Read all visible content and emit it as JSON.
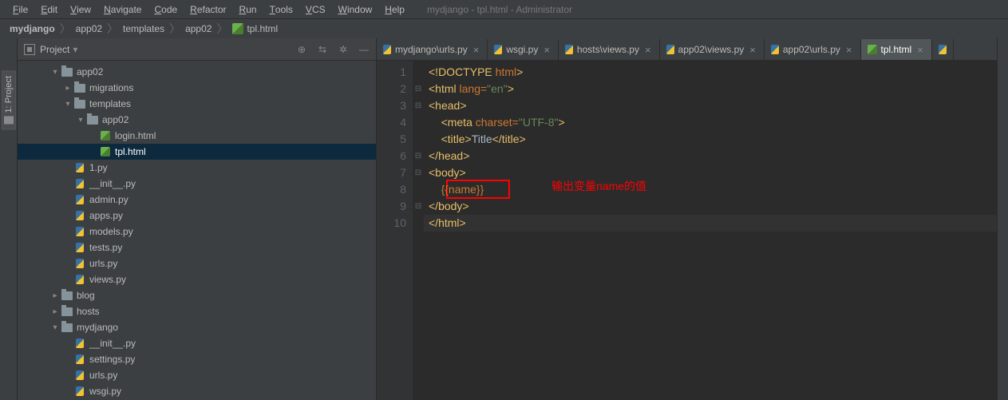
{
  "menu": {
    "items": [
      "File",
      "Edit",
      "View",
      "Navigate",
      "Code",
      "Refactor",
      "Run",
      "Tools",
      "VCS",
      "Window",
      "Help"
    ]
  },
  "title": "mydjango - tpl.html - Administrator",
  "breadcrumb": [
    "mydjango",
    "app02",
    "templates",
    "app02",
    "tpl.html"
  ],
  "sidebar_tab": "1: Project",
  "project_header": {
    "label": "Project"
  },
  "tree": [
    {
      "d": 2,
      "a": "v",
      "t": "folder",
      "n": "app02"
    },
    {
      "d": 3,
      "a": ">",
      "t": "folder",
      "n": "migrations"
    },
    {
      "d": 3,
      "a": "v",
      "t": "folder",
      "n": "templates"
    },
    {
      "d": 4,
      "a": "v",
      "t": "folder",
      "n": "app02"
    },
    {
      "d": 5,
      "a": "",
      "t": "html",
      "n": "login.html"
    },
    {
      "d": 5,
      "a": "",
      "t": "html",
      "n": "tpl.html",
      "sel": true
    },
    {
      "d": 3,
      "a": "",
      "t": "py",
      "n": "1.py"
    },
    {
      "d": 3,
      "a": "",
      "t": "py",
      "n": "__init__.py"
    },
    {
      "d": 3,
      "a": "",
      "t": "py",
      "n": "admin.py"
    },
    {
      "d": 3,
      "a": "",
      "t": "py",
      "n": "apps.py"
    },
    {
      "d": 3,
      "a": "",
      "t": "py",
      "n": "models.py"
    },
    {
      "d": 3,
      "a": "",
      "t": "py",
      "n": "tests.py"
    },
    {
      "d": 3,
      "a": "",
      "t": "py",
      "n": "urls.py"
    },
    {
      "d": 3,
      "a": "",
      "t": "py",
      "n": "views.py"
    },
    {
      "d": 2,
      "a": ">",
      "t": "folder",
      "n": "blog"
    },
    {
      "d": 2,
      "a": ">",
      "t": "folder",
      "n": "hosts"
    },
    {
      "d": 2,
      "a": "v",
      "t": "folder",
      "n": "mydjango"
    },
    {
      "d": 3,
      "a": "",
      "t": "py",
      "n": "__init__.py"
    },
    {
      "d": 3,
      "a": "",
      "t": "py",
      "n": "settings.py"
    },
    {
      "d": 3,
      "a": "",
      "t": "py",
      "n": "urls.py"
    },
    {
      "d": 3,
      "a": "",
      "t": "py",
      "n": "wsgi.py"
    }
  ],
  "tabs": [
    {
      "icon": "py",
      "label": "mydjango\\urls.py"
    },
    {
      "icon": "py",
      "label": "wsgi.py"
    },
    {
      "icon": "py",
      "label": "hosts\\views.py"
    },
    {
      "icon": "py",
      "label": "app02\\views.py"
    },
    {
      "icon": "py",
      "label": "app02\\urls.py"
    },
    {
      "icon": "html",
      "label": "tpl.html",
      "active": true
    }
  ],
  "code": {
    "lines": [
      {
        "n": 1,
        "seg": [
          [
            "tag",
            "<!DOCTYPE "
          ],
          [
            "attr",
            "html"
          ],
          [
            "tag",
            ">"
          ]
        ]
      },
      {
        "n": 2,
        "fold": "-",
        "seg": [
          [
            "tag",
            "<html "
          ],
          [
            "attr",
            "lang="
          ],
          [
            "str",
            "\"en\""
          ],
          [
            "tag",
            ">"
          ]
        ]
      },
      {
        "n": 3,
        "fold": "-",
        "seg": [
          [
            "tag",
            "<head>"
          ]
        ]
      },
      {
        "n": 4,
        "seg": [
          [
            "txt",
            "    "
          ],
          [
            "tag",
            "<meta "
          ],
          [
            "attr",
            "charset="
          ],
          [
            "str",
            "\"UTF-8\""
          ],
          [
            "tag",
            ">"
          ]
        ]
      },
      {
        "n": 5,
        "seg": [
          [
            "txt",
            "    "
          ],
          [
            "tag",
            "<title>"
          ],
          [
            "txt",
            "Title"
          ],
          [
            "tag",
            "</title>"
          ]
        ]
      },
      {
        "n": 6,
        "fold": "-",
        "seg": [
          [
            "tag",
            "</head>"
          ]
        ]
      },
      {
        "n": 7,
        "fold": "-",
        "seg": [
          [
            "tag",
            "<body>"
          ]
        ]
      },
      {
        "n": 8,
        "seg": [
          [
            "txt",
            "    "
          ],
          [
            "var",
            "{{name}}"
          ]
        ]
      },
      {
        "n": 9,
        "fold": "-",
        "seg": [
          [
            "tag",
            "</body>"
          ]
        ]
      },
      {
        "n": 10,
        "seg": [
          [
            "tag",
            "</html>"
          ]
        ],
        "cursor": true
      }
    ]
  },
  "annotation": {
    "text": "输出变量name的值"
  }
}
